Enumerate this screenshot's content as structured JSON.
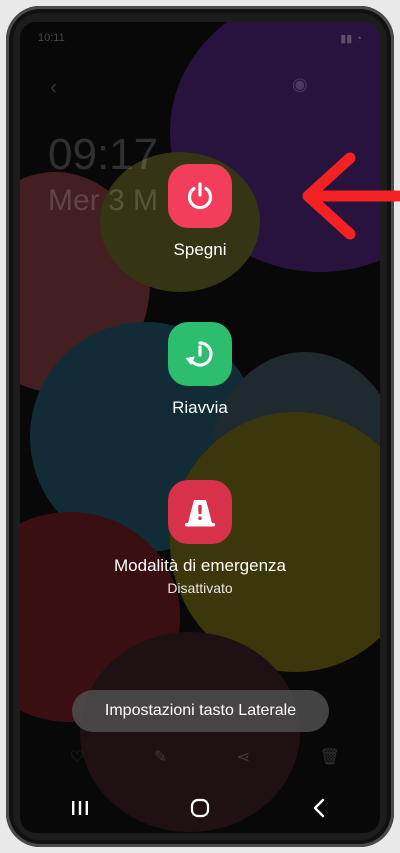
{
  "status_bar": {
    "time": "10:11"
  },
  "lockscreen": {
    "time": "09:17",
    "date": "Mer 3 M"
  },
  "power_menu": {
    "power_off_label": "Spegni",
    "restart_label": "Riavvia",
    "emergency_label": "Modalità di emergenza",
    "emergency_status": "Disattivato",
    "side_key_settings_label": "Impostazioni tasto Laterale"
  },
  "colors": {
    "power_off": "#f23d5b",
    "restart": "#2dbd6e",
    "emergency": "#d8314a",
    "annotation_arrow": "#f22222"
  },
  "icons": {
    "power_off": "power-icon",
    "restart": "restart-icon",
    "emergency": "emergency-mode-icon",
    "nav_recents": "recents-icon",
    "nav_home": "home-icon",
    "nav_back": "back-icon"
  }
}
